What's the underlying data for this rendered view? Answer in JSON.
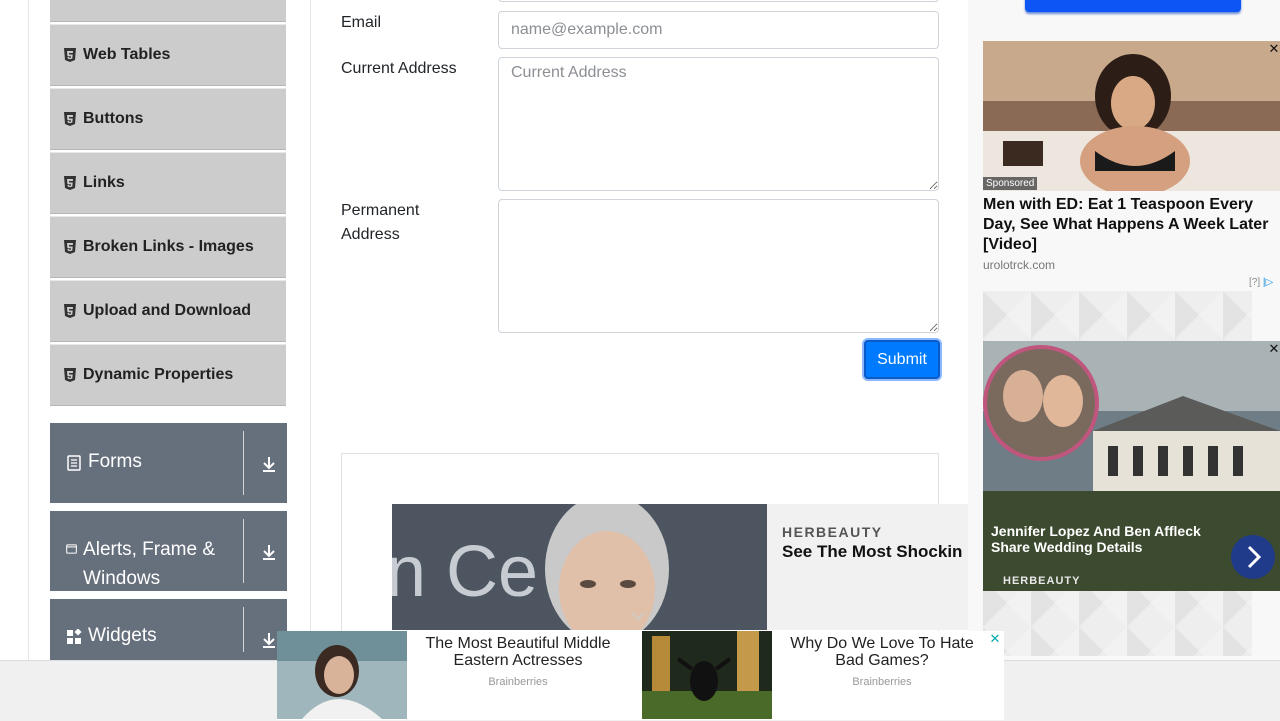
{
  "sidebar": {
    "items": [
      {
        "label": ""
      },
      {
        "label": "Web Tables"
      },
      {
        "label": "Buttons"
      },
      {
        "label": "Links"
      },
      {
        "label": "Broken Links - Images"
      },
      {
        "label": "Upload and Download"
      },
      {
        "label": "Dynamic Properties"
      }
    ],
    "groups": [
      {
        "label": "Forms",
        "icon": "document-icon"
      },
      {
        "label": "Alerts, Frame & Windows",
        "icon": "window-icon"
      },
      {
        "label": "Widgets",
        "icon": "widgets-icon"
      }
    ]
  },
  "form": {
    "email_label": "Email",
    "email_placeholder": "name@example.com",
    "current_address_label": "Current Address",
    "current_address_placeholder": "Current Address",
    "permanent_address_label": "Permanent Address",
    "submit_label": "Submit"
  },
  "ads": {
    "right1": {
      "sponsored": "Sponsored",
      "title": "Men with ED: Eat 1 Teaspoon Every Day, See What Happens A Week Later [Video]",
      "source": "urolotrck.com",
      "info": "[?]"
    },
    "right2": {
      "title": "Jennifer Lopez And Ben Affleck Share Wedding Details",
      "brand": "HERBEAUTY"
    },
    "middle": {
      "brand": "HERBEAUTY",
      "title": "See The Most Shockin"
    },
    "bottom": [
      {
        "title": "The Most Beautiful Middle Eastern Actresses",
        "brand": "Brainberries"
      },
      {
        "title": "Why Do We Love To Hate Bad Games?",
        "brand": "Brainberries"
      }
    ]
  },
  "colors": {
    "sidebar_item_bg": "#cccccc",
    "group_header_bg": "#666f7c",
    "submit_bg": "#007bff"
  }
}
